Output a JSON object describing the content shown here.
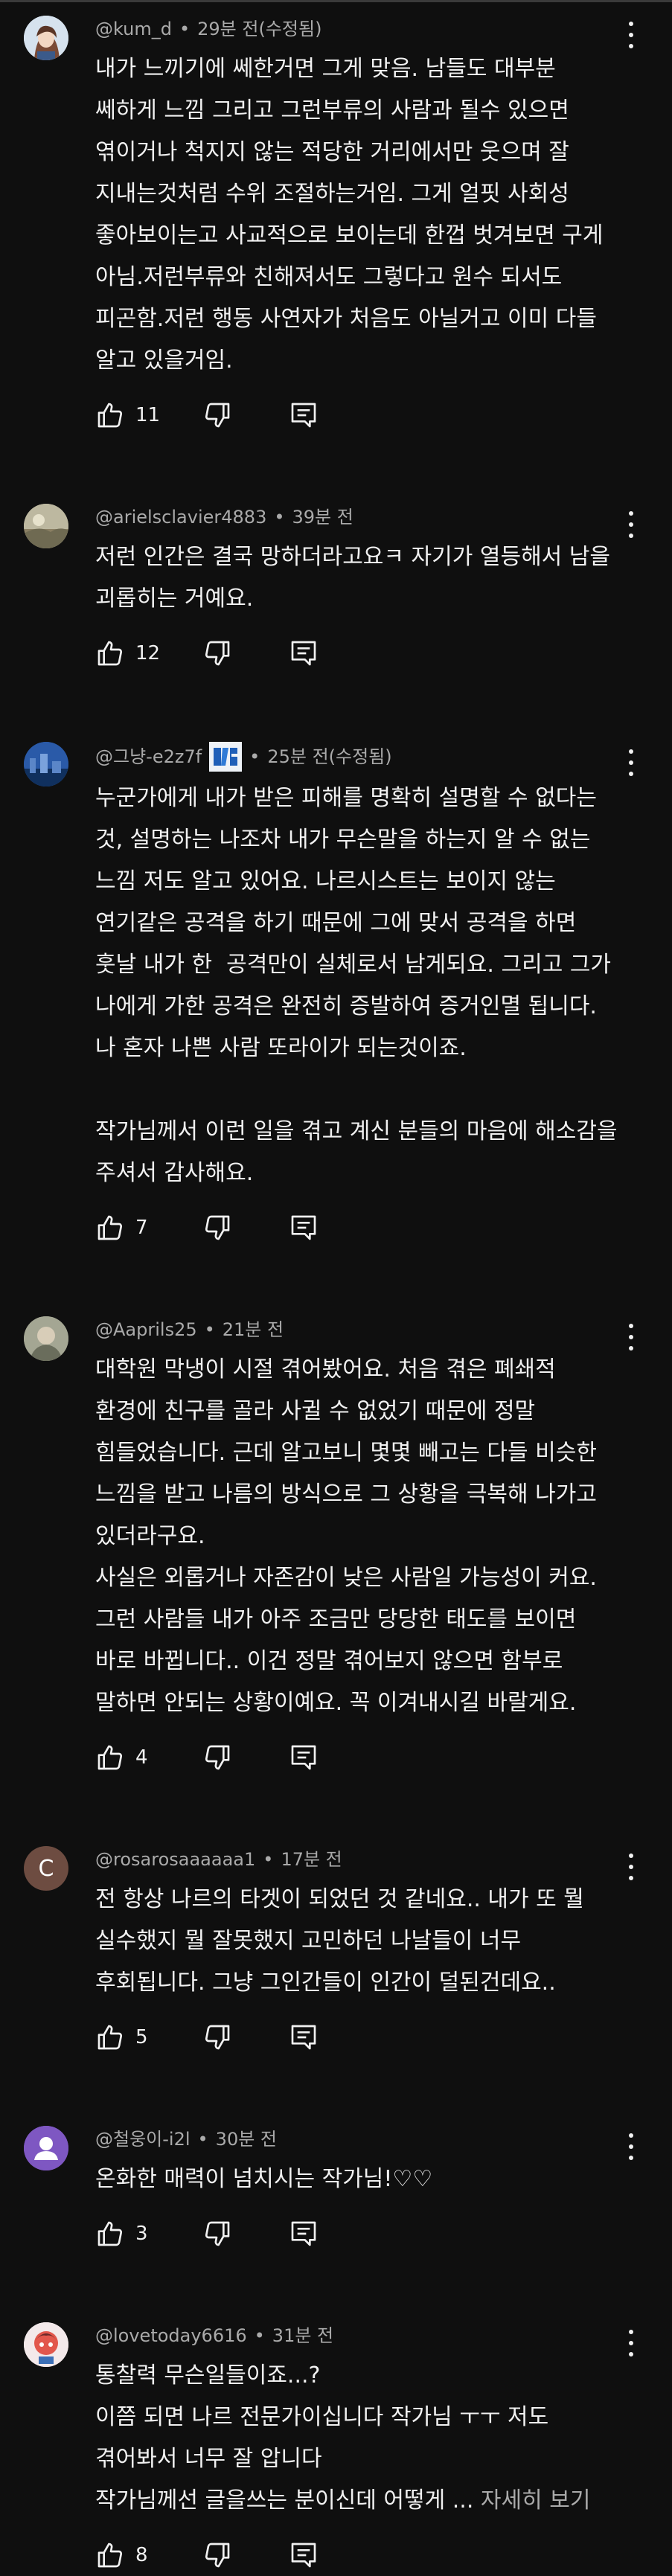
{
  "comments": [
    {
      "author": "@kum_d",
      "time": "29분 전(수정됨)",
      "text": "내가 느끼기에 쎄한거면 그게 맞음. 남들도 대부분\n쎄하게 느낌 그리고 그런부류의 사람과 될수 있으면\n엮이거나 척지지 않는 적당한 거리에서만 웃으며 잘\n지내는것처럼 수위 조절하는거임. 그게 얼핏 사회성\n좋아보이는고 사교적으로 보이는데 한껍 벗겨보면 구게\n아님.저런부류와 친해져서도 그렇다고 원수 되서도\n피곤함.저런 행동 사연자가 처음도 아닐거고 이미 다들\n알고 있을거임.",
      "likes": "11",
      "avatar": "anime-portrait"
    },
    {
      "author": "@arielsclavier4883",
      "time": "39분 전",
      "text": "저런 인간은 결국 망하더라고요ㅋ 자기가 열등해서 남을\n괴롭히는 거예요.",
      "likes": "12",
      "avatar": "landscape"
    },
    {
      "author": "@그냥-e2z7f",
      "time": "25분 전(수정됨)",
      "text": "누군가에게 내가 받은 피해를 명확히 설명할 수 없다는\n것, 설명하는 나조차 내가 무슨말을 하는지 알 수 없는\n느낌 저도 알고 있어요. 나르시스트는 보이지 않는\n연기같은 공격을 하기 때문에 그에 맞서 공격을 하면\n훗날 내가 한  공격만이 실체로서 남게되요. 그리고 그가\n나에게 가한 공격은 완전히 증발하여 증거인멸 됩니다.\n나 혼자 나쁜 사람 또라이가 되는것이죠.\n\n작가님께서 이런 일을 겪고 계신 분들의 마음에 해소감을\n주셔서 감사해요.",
      "likes": "7",
      "avatar": "blue-city",
      "badge": true
    },
    {
      "author": "@Aaprils25",
      "time": "21분 전",
      "text": "대학원 막냉이 시절 겪어봤어요. 처음 겪은 폐쇄적\n환경에 친구를 골라 사귈 수 없었기 때문에 정말\n힘들었습니다. 근데 알고보니 몇몇 빼고는 다들 비슷한\n느낌을 받고 나름의 방식으로 그 상황을 극복해 나가고\n있더라구요.\n사실은 외롭거나 자존감이 낮은 사람일 가능성이 커요.\n그런 사람들 내가 아주 조금만 당당한 태도를 보이면\n바로 바뀝니다.. 이건 정말 겪어보지 않으면 함부로\n말하면 안되는 상황이예요. 꼭 이겨내시길 바랄게요.",
      "likes": "4",
      "avatar": "photo"
    },
    {
      "author": "@rosarosaaaaaa1",
      "time": "17분 전",
      "text": "전 항상 나르의 타겟이 되었던 것 같네요.. 내가 또 뭘\n실수했지 뭘 잘못했지 고민하던 나날들이 너무\n후회됩니다. 그냥 그인간들이 인간이 덜된건데요..",
      "likes": "5",
      "avatar": "letter",
      "avatar_letter": "C",
      "avatar_color": "#6d4c41"
    },
    {
      "author": "@철웅이-i2l",
      "time": "30분 전",
      "text": "온화한 매력이 넘치시는 작가님!♡♡",
      "likes": "3",
      "avatar": "default-person",
      "avatar_color": "#7e57c2"
    },
    {
      "author": "@lovetoday6616",
      "time": "31분 전",
      "text": "통찰력 무슨일들이죠...?\n이쯤 되면 나르 전문가이십니다 작가님 ㅜㅜ 저도\n겪어봐서 너무 잘 압니다\n작가님께선 글을쓰는 분이신데 어떻게 ... ",
      "more": "자세히 보기",
      "likes": "8",
      "avatar": "cartoon"
    }
  ],
  "icons": {
    "like": "thumbs-up-icon",
    "dislike": "thumbs-down-icon",
    "reply": "reply-comment-icon",
    "menu": "more-vertical-icon"
  }
}
